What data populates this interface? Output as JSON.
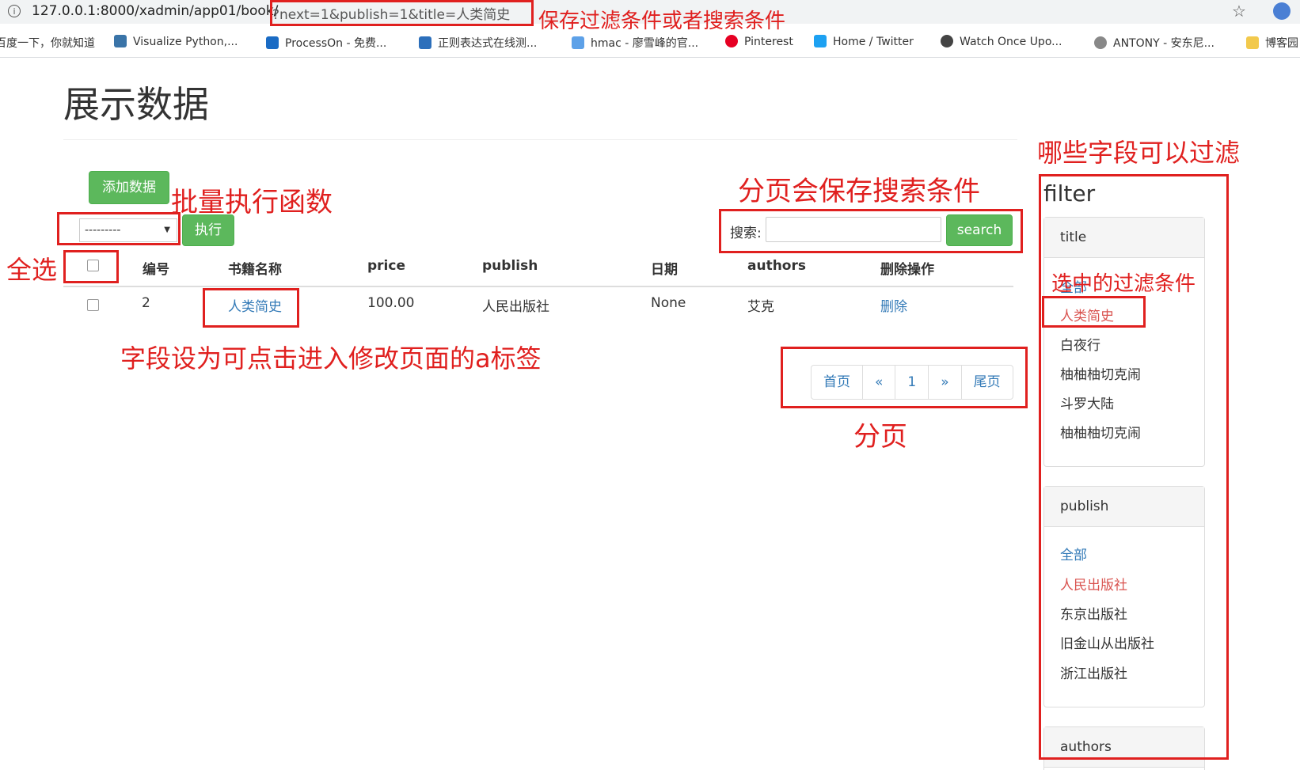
{
  "browser": {
    "url_base": "127.0.0.1:8000/xadmin/app01/book/",
    "url_query": "?next=1&publish=1&title=人类简史",
    "bookmarks": [
      {
        "label": "百度一下，你就知道",
        "color": "#e0201f"
      },
      {
        "label": "Visualize Python,...",
        "color": "#3a74a8"
      },
      {
        "label": "ProcessOn - 免费...",
        "color": "#1a6bc4"
      },
      {
        "label": "正则表达式在线测...",
        "color": "#2c6fbb"
      },
      {
        "label": "hmac - 廖雪峰的官...",
        "color": "#5da1e8"
      },
      {
        "label": "Pinterest",
        "color": "#e60023"
      },
      {
        "label": "Home / Twitter",
        "color": "#1da1f2"
      },
      {
        "label": "Watch Once Upo...",
        "color": "#444444"
      },
      {
        "label": "ANTONY - 安东尼...",
        "color": "#888888"
      },
      {
        "label": "博客园",
        "color": "#f2c94c"
      }
    ]
  },
  "page": {
    "title": "展示数据",
    "add_button": "添加数据",
    "action_select": "---------",
    "execute_button": "执行",
    "search_label": "搜索:",
    "search_value": "",
    "search_button": "search"
  },
  "table": {
    "headers": [
      "编号",
      "书籍名称",
      "price",
      "publish",
      "日期",
      "authors",
      "删除操作"
    ],
    "rows": [
      {
        "id": "2",
        "title": "人类简史",
        "price": "100.00",
        "publish": "人民出版社",
        "date": "None",
        "authors": "艾克",
        "delete": "删除"
      }
    ]
  },
  "pagination": [
    "首页",
    "«",
    "1",
    "»",
    "尾页"
  ],
  "filter": {
    "heading": "filter",
    "title_panel": {
      "heading": "title",
      "items": [
        "全部",
        "人类简史",
        "白夜行",
        "柚柚柚切克闹",
        "斗罗大陆",
        "柚柚柚切克闹"
      ]
    },
    "publish_panel": {
      "heading": "publish",
      "items": [
        "全部",
        "人民出版社",
        "东京出版社",
        "旧金山从出版社",
        "浙江出版社"
      ]
    },
    "authors_panel": {
      "heading": "authors"
    }
  },
  "annotations": {
    "url": "保存过滤条件或者搜索条件",
    "batch": "批量执行函数",
    "select_all": "全选",
    "link_field": "字段设为可点击进入修改页面的a标签",
    "search": "分页会保存搜索条件",
    "pagination": "分页",
    "filter_fields": "哪些字段可以过滤",
    "selected_filter": "选中的过滤条件"
  },
  "colors": {
    "annotation_red": "#e0201f",
    "button_green": "#5cb85c",
    "link_blue": "#337ab7",
    "active_filter": "#d9534f"
  }
}
